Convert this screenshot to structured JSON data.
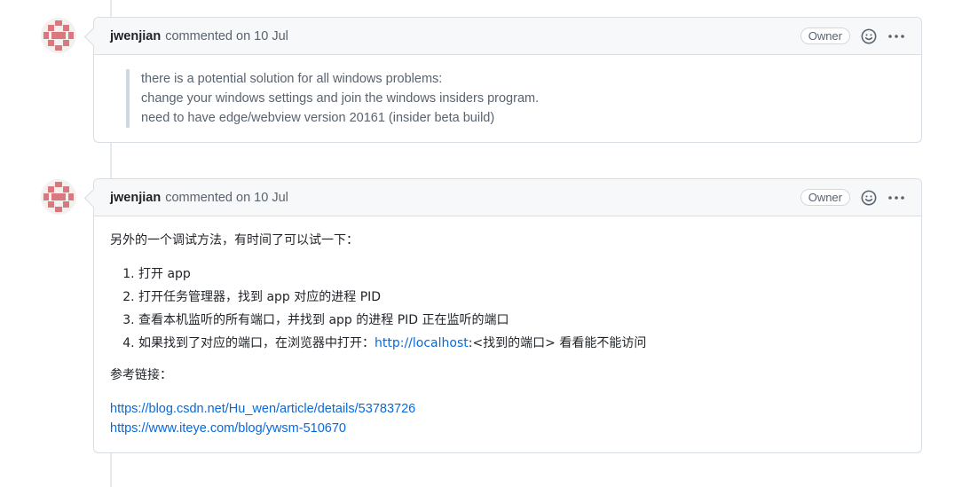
{
  "comments": [
    {
      "author": "jwenjian",
      "meta": "commented on 10 Jul",
      "badge": "Owner",
      "quote_lines": [
        "there is a potential solution for all windows problems:",
        "change your windows settings and join the windows insiders program.",
        "need to have edge/webview version 20161 (insider beta build)"
      ]
    },
    {
      "author": "jwenjian",
      "meta": "commented on 10 Jul",
      "badge": "Owner",
      "intro": "另外的一个调试方法，有时间了可以试一下：",
      "steps": [
        "打开 app",
        "打开任务管理器，找到 app 对应的进程 PID",
        "查看本机监听的所有端口，并找到 app 的进程 PID 正在监听的端口"
      ],
      "step4_prefix": "如果找到了对应的端口，在浏览器中打开：",
      "step4_link": "http://localhost",
      "step4_suffix": ":<找到的端口> 看看能不能访问",
      "ref_label": "参考链接：",
      "links": [
        "https://blog.csdn.net/Hu_wen/article/details/53783726",
        "https://www.iteye.com/blog/ywsm-510670"
      ]
    }
  ],
  "icons": {
    "emoji": "smiley-icon",
    "more": "kebab-horizontal-icon",
    "avatar": "identicon"
  },
  "colors": {
    "link": "#0969da",
    "identicon": "#d9787d"
  }
}
